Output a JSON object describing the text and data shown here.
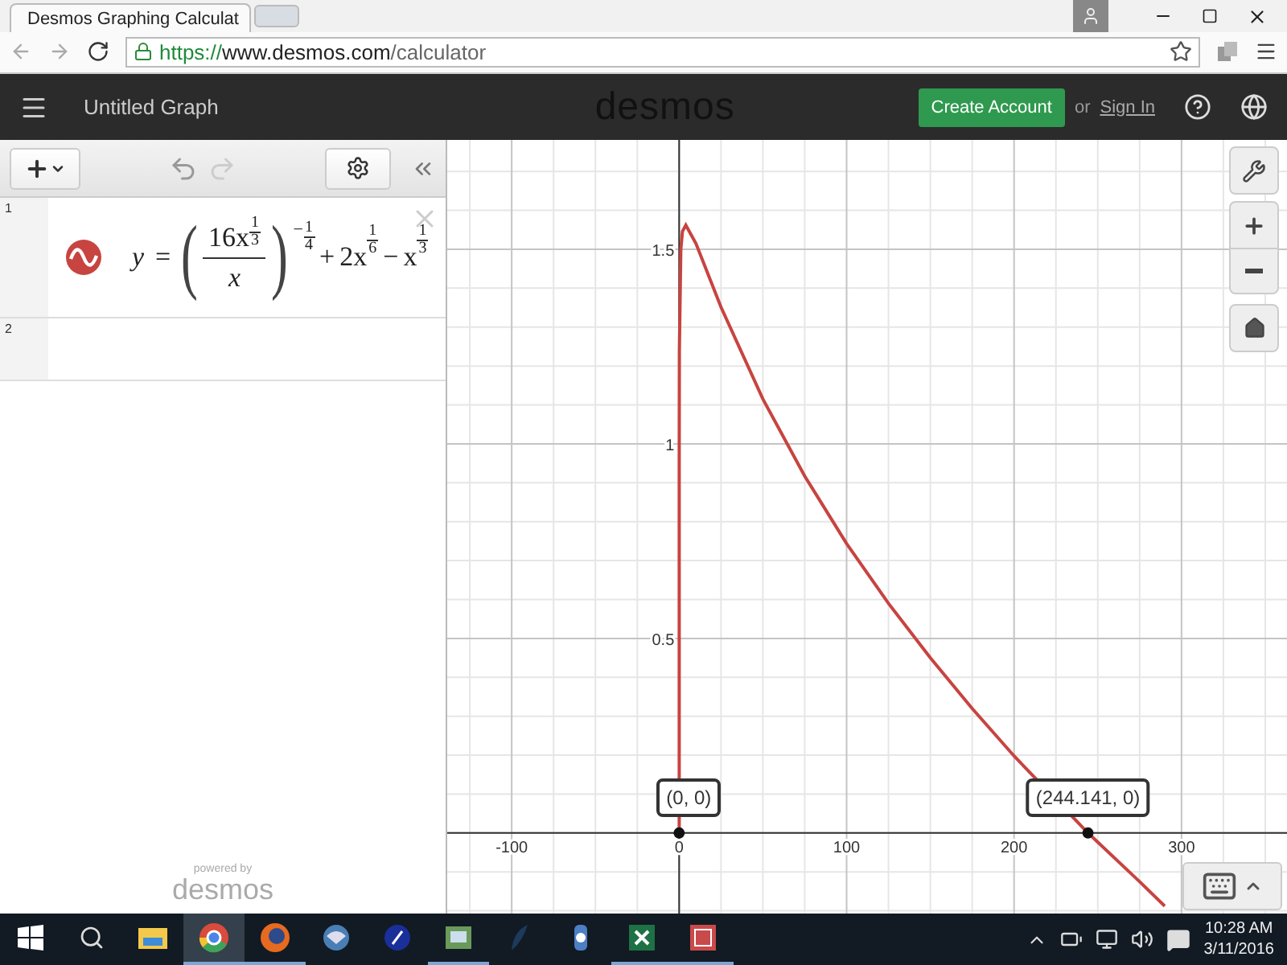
{
  "browser": {
    "tabs": [
      {
        "title": "Desmos Graphing Calculat",
        "selected": true
      }
    ],
    "url": {
      "scheme": "https://",
      "host": "www.desmos.com",
      "path": "/calculator"
    }
  },
  "header": {
    "title": "Untitled Graph",
    "logo": "desmos",
    "create_account": "Create Account",
    "or": "or",
    "sign_in": "Sign In"
  },
  "expressions": [
    {
      "number": "1",
      "lhs": "y",
      "relation": "=",
      "open_paren": "(",
      "numerator": "16x",
      "numerator_exponent": [
        "1",
        "3"
      ],
      "denominator": "x",
      "close_paren": ")",
      "paren_exponent": {
        "sign": "−",
        "fraction": [
          "1",
          "4"
        ]
      },
      "terms": [
        {
          "op": "+",
          "base": "2x",
          "exponent": [
            "1",
            "6"
          ]
        },
        {
          "op": "−",
          "base": "x",
          "exponent": [
            "1",
            "3"
          ]
        }
      ]
    },
    {
      "number": "2"
    }
  ],
  "powered_by": {
    "caption": "powered by",
    "logo": "desmos"
  },
  "graph": {
    "chart_data": {
      "type": "line",
      "grid": true,
      "xlim": [
        -138.5,
        363
      ],
      "ylim": [
        -0.207,
        1.781
      ],
      "xticks": [
        -100,
        0,
        100,
        200,
        300
      ],
      "yticks": [
        0.5,
        1,
        1.5
      ],
      "x": [
        0,
        0.01,
        0.1,
        1,
        2,
        4,
        10,
        25,
        50,
        75,
        100,
        125,
        150,
        175,
        200,
        225,
        244.141,
        275,
        290
      ],
      "series": [
        {
          "color": "#c74440",
          "values": [
            0,
            0.945,
            1.239,
            1.5,
            1.546,
            1.562,
            1.515,
            1.351,
            1.115,
            0.917,
            0.744,
            0.59,
            0.45,
            0.32,
            0.198,
            null,
            0,
            -0.125,
            -0.188
          ]
        }
      ],
      "annotations": [
        {
          "x": 0,
          "y": 0,
          "text": "(0, 0)"
        },
        {
          "x": 244.141,
          "y": 0,
          "text": "(244.141, 0)"
        }
      ]
    }
  },
  "taskbar": {
    "apps": [
      {
        "kind": "folder",
        "selected": false,
        "open": false
      },
      {
        "kind": "chrome",
        "selected": true,
        "open": true
      },
      {
        "kind": "firefox",
        "selected": false,
        "open": true
      },
      {
        "kind": "bird",
        "selected": false,
        "open": false
      },
      {
        "kind": "compass",
        "selected": false,
        "open": false
      },
      {
        "kind": "box",
        "selected": false,
        "open": true
      },
      {
        "kind": "feather",
        "selected": false,
        "open": false
      },
      {
        "kind": "gear",
        "selected": false,
        "open": false
      },
      {
        "kind": "spreadsheet",
        "selected": false,
        "open": true
      },
      {
        "kind": "slides",
        "selected": false,
        "open": true
      }
    ],
    "time": "10:28 AM",
    "date": "3/11/2016"
  }
}
